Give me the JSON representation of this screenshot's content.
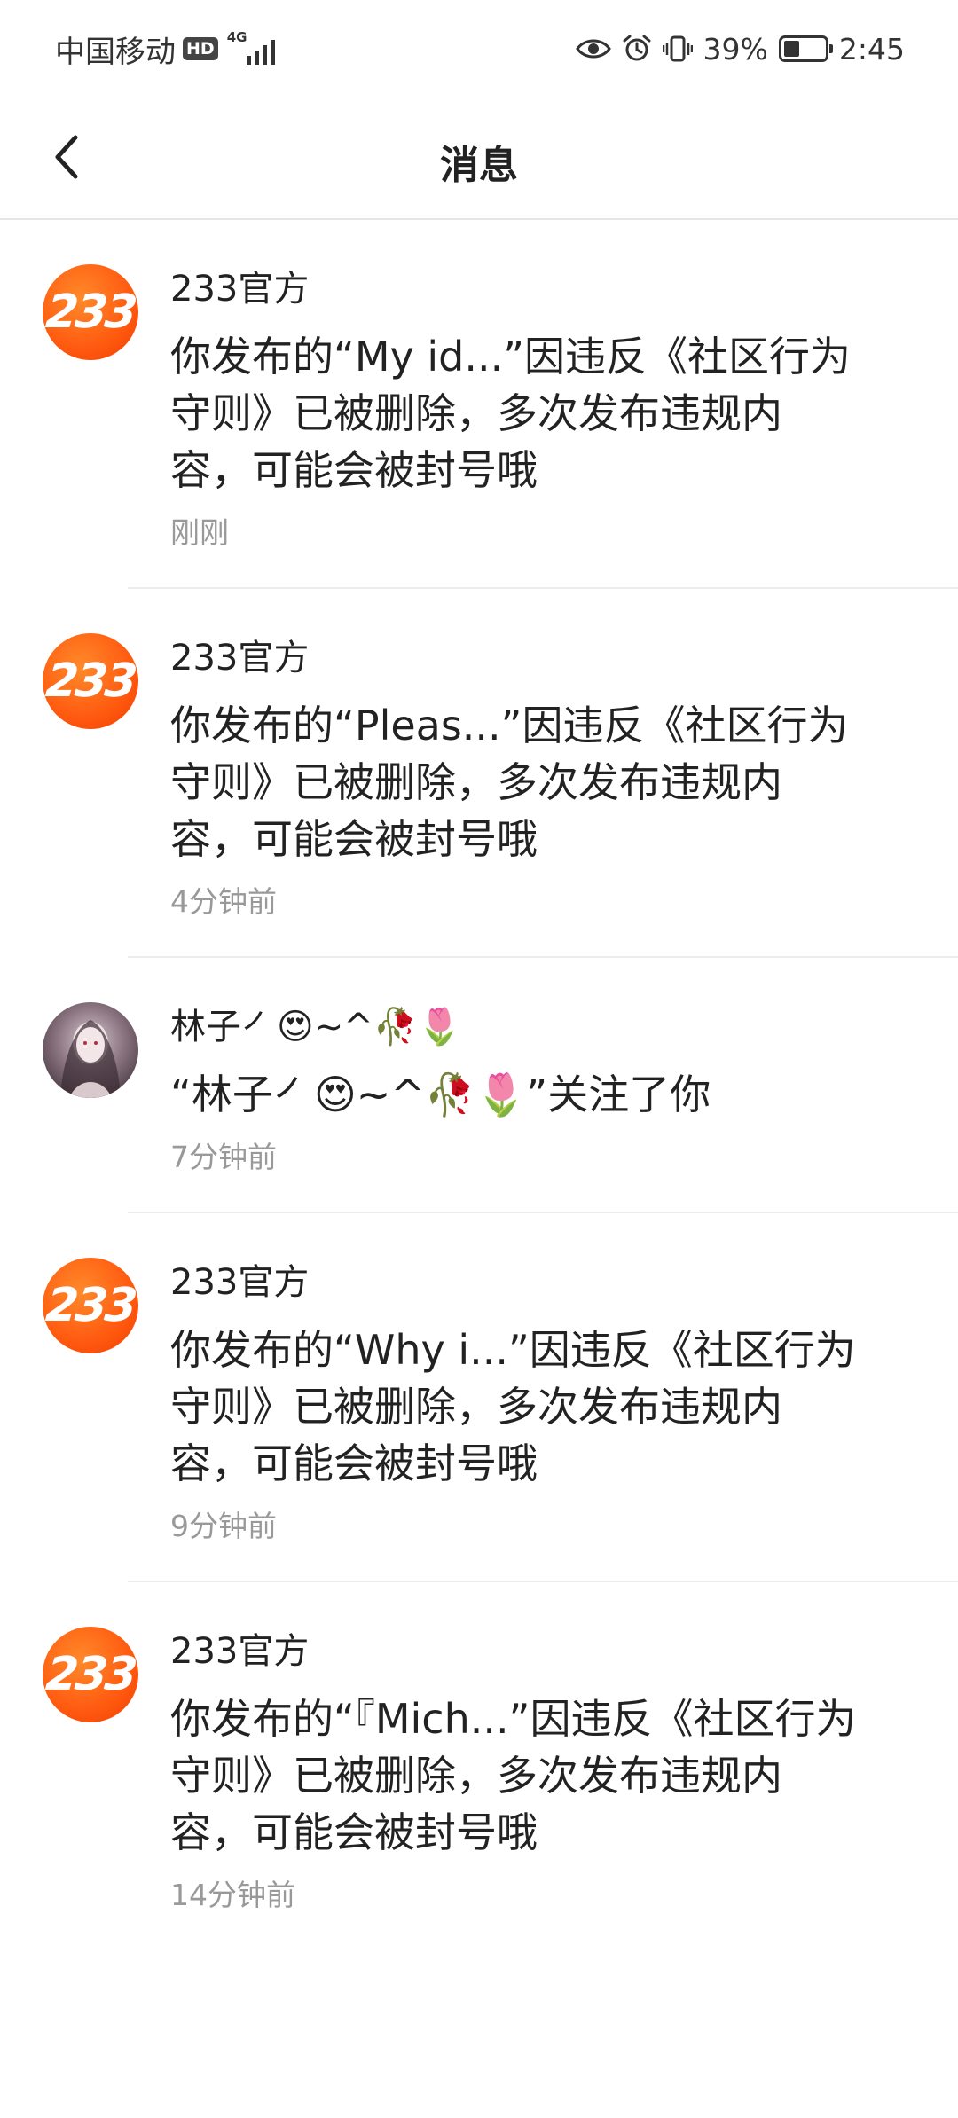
{
  "status_bar": {
    "carrier": "中国移动",
    "hd": "HD",
    "network": "4G",
    "battery_percent_text": "39%",
    "battery_level": 0.39,
    "time": "2:45",
    "icons": [
      "eye-icon",
      "alarm-icon",
      "vibrate-icon",
      "battery-icon"
    ]
  },
  "header": {
    "title": "消息",
    "back_icon": "chevron-left-icon"
  },
  "messages": [
    {
      "sender": "233官方",
      "avatar_text": "233",
      "content": "你发布的“My id...”因违反《社区行为守则》已被删除，多次发布违规内容，可能会被封号哦",
      "time": "刚刚"
    },
    {
      "sender": "233官方",
      "avatar_text": "233",
      "content": "你发布的“Pleas...”因违反《社区行为守则》已被删除，多次发布违规内容，可能会被封号哦",
      "time": "4分钟前"
    },
    {
      "sender": "林子㇒😍~^🥀🌷",
      "avatar_text": "",
      "content": "“林子㇒😍~^🥀🌷”关注了你",
      "time": "7分钟前"
    },
    {
      "sender": "233官方",
      "avatar_text": "233",
      "content": "你发布的“Why i...”因违反《社区行为守则》已被删除，多次发布违规内容，可能会被封号哦",
      "time": "9分钟前"
    },
    {
      "sender": "233官方",
      "avatar_text": "233",
      "content": "你发布的“『Mich...”因违反《社区行为守则》已被删除，多次发布违规内容，可能会被封号哦",
      "time": "14分钟前"
    }
  ],
  "colors": {
    "brand_orange": "#ff5a10",
    "text_primary": "#222222",
    "text_secondary": "#999999",
    "divider": "#ececec"
  }
}
